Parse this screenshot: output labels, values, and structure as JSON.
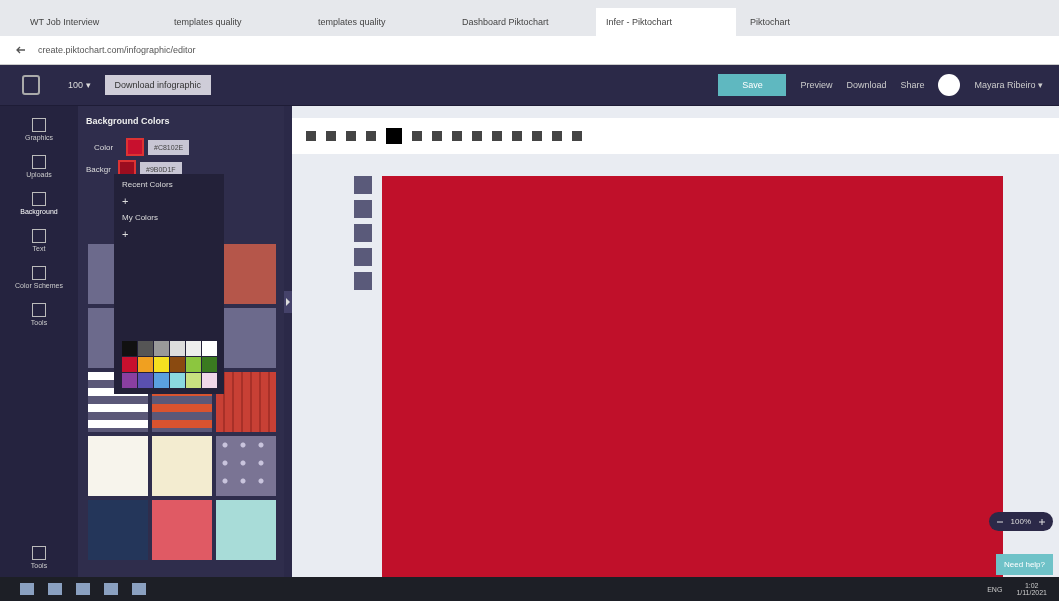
{
  "browser": {
    "tabs": [
      {
        "label": "WT Job Interview",
        "selected": false
      },
      {
        "label": "templates quality",
        "selected": false
      },
      {
        "label": "templates quality",
        "selected": false
      },
      {
        "label": "Dashboard Piktochart",
        "selected": false
      },
      {
        "label": "Infer - Piktochart",
        "selected": true
      },
      {
        "label": "Piktochart",
        "selected": false
      }
    ],
    "url": "create.piktochart.com/infographic/editor"
  },
  "topbar": {
    "size": "100 ▾",
    "template_button": "Download infographic",
    "save": "Save",
    "actions": [
      "Preview",
      "Download",
      "Share"
    ],
    "user": "Mayara Ribeiro ▾"
  },
  "rail": [
    {
      "label": "Graphics",
      "selected": false
    },
    {
      "label": "Uploads",
      "selected": false
    },
    {
      "label": "Background",
      "selected": true
    },
    {
      "label": "Text",
      "selected": false
    },
    {
      "label": "Color Schemes",
      "selected": false
    },
    {
      "label": "Tools",
      "selected": false
    }
  ],
  "rail_bottom": "Tools",
  "panel": {
    "title": "Background Colors",
    "color_label": "Color",
    "color_value": "#C8102E",
    "second_value": "#9B0D1F",
    "patterns_label": "Backgr",
    "patterns": [
      {
        "color": "#6c6a8c",
        "kind": "plain"
      },
      {
        "kind": "covered"
      },
      {
        "color": "#b5564a",
        "kind": "plain"
      },
      {
        "color": "#6c6a8c",
        "kind": "plain"
      },
      {
        "kind": "covered"
      },
      {
        "color": "#6c6a8c",
        "kind": "plain"
      },
      {
        "color": "#ffffff",
        "kind": "hstripes"
      },
      {
        "color": "#d9532f",
        "kind": "hstripes"
      },
      {
        "color": "#c84035",
        "kind": "vstripes"
      },
      {
        "color": "#f7f4ec",
        "kind": "plain"
      },
      {
        "color": "#f3ecd0",
        "kind": "plain"
      },
      {
        "color": "#7a7494",
        "kind": "dots"
      },
      {
        "color": "#24365a",
        "kind": "plain"
      },
      {
        "color": "#e05a64",
        "kind": "plain"
      },
      {
        "color": "#a8dcd8",
        "kind": "plain"
      }
    ]
  },
  "popup": {
    "recent_label": "Recent Colors",
    "my_label": "My Colors",
    "add": "+",
    "add_my": "+",
    "swatches": [
      {
        "color": "#111111"
      },
      {
        "color": "#555555"
      },
      {
        "color": "#999999"
      },
      {
        "color": "#dddddd"
      },
      {
        "color": "#eeeeee"
      },
      {
        "color": "#ffffff"
      },
      {
        "color": "#c8102e"
      },
      {
        "color": "#f0a020"
      },
      {
        "color": "#f5e020"
      },
      {
        "color": "#8a4a10"
      },
      {
        "color": "#8cc63f"
      },
      {
        "color": "#3a7a20"
      },
      {
        "color": "#8a3fa0"
      },
      {
        "color": "#5a50b0"
      },
      {
        "color": "#5aa0e0"
      },
      {
        "color": "#8ad8e0"
      },
      {
        "color": "#c8e080"
      },
      {
        "color": "#f0d8e8"
      }
    ]
  },
  "canvas": {
    "color": "#c0102a",
    "zoom": "100%",
    "help": "Need help?"
  },
  "taskbar": {
    "time": "1:02",
    "date": "1/11/2021",
    "lang": "ENG"
  }
}
